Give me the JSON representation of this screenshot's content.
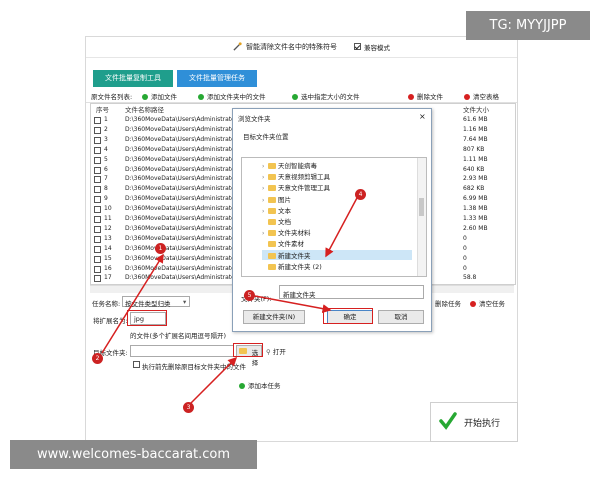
{
  "app": {
    "title": "智能清除文件名中的特殊符号",
    "compat_label": "兼容模式",
    "compat_checked": true,
    "tabs": [
      "文件批量复制工具",
      "文件批量管理任务"
    ],
    "colors": {
      "tab_active": "#1f9e8c",
      "tab_inactive": "#2f8fd8",
      "red": "#d62020",
      "green": "#27a833"
    }
  },
  "toolbar": {
    "list_label": "原文件名列表:",
    "add_files": "添加文件",
    "add_folder_files": "添加文件夹中的文件",
    "select_by_size": "选中指定大小的文件",
    "delete_files": "删除文件",
    "clear_table": "清空表格"
  },
  "table": {
    "headers": [
      "序号",
      "文件名称路径",
      "文件大小"
    ],
    "rows": [
      {
        "no": "1",
        "path": "D:\\360MoveData\\Users\\Administrator\\",
        "size": "61.6 MB"
      },
      {
        "no": "2",
        "path": "D:\\360MoveData\\Users\\Administrator\\",
        "size": "1.16 MB"
      },
      {
        "no": "3",
        "path": "D:\\360MoveData\\Users\\Administrator\\",
        "size": "7.64 MB"
      },
      {
        "no": "4",
        "path": "D:\\360MoveData\\Users\\Administrator\\",
        "size": "807 KB"
      },
      {
        "no": "5",
        "path": "D:\\360MoveData\\Users\\Administrator\\",
        "size": "1.11 MB"
      },
      {
        "no": "6",
        "path": "D:\\360MoveData\\Users\\Administrator\\",
        "size": "640 KB"
      },
      {
        "no": "7",
        "path": "D:\\360MoveData\\Users\\Administrator\\",
        "size": "2.93 MB"
      },
      {
        "no": "8",
        "path": "D:\\360MoveData\\Users\\Administrator\\",
        "size": "682 KB"
      },
      {
        "no": "9",
        "path": "D:\\360MoveData\\Users\\Administrator\\",
        "size": "6.99 MB"
      },
      {
        "no": "10",
        "path": "D:\\360MoveData\\Users\\Administrator\\",
        "size": "1.38 MB"
      },
      {
        "no": "11",
        "path": "D:\\360MoveData\\Users\\Administrator\\",
        "size": "1.33 MB"
      },
      {
        "no": "12",
        "path": "D:\\360MoveData\\Users\\Administrator\\",
        "size": "2.60 MB"
      },
      {
        "no": "13",
        "path": "D:\\360MoveData\\Users\\Administrator\\",
        "size": "0"
      },
      {
        "no": "14",
        "path": "D:\\360MoveData\\Users\\Administrator\\",
        "size": "0"
      },
      {
        "no": "15",
        "path": "D:\\360MoveData\\Users\\Administrator\\",
        "size": "0"
      },
      {
        "no": "16",
        "path": "D:\\360MoveData\\Users\\Administrator\\",
        "size": "0"
      },
      {
        "no": "17",
        "path": "D:\\360MoveData\\Users\\Administrator\\",
        "size": "58.8"
      }
    ]
  },
  "task": {
    "name_label": "任务名称:",
    "name_value": "按文件类型归类",
    "ext_label": "将扩展名为:",
    "ext_value": "jpg",
    "ext_hint": "的文件(多个扩展名间用逗号隔开)",
    "target_label": "目标文件夹:",
    "select_btn": "选择",
    "open_btn": "打开",
    "delete_before": "执行前先删除原目标文件夹中的文件",
    "add_task": "添加本任务",
    "delete_task": "删除任务",
    "clear_task": "清空任务",
    "start": "开始执行"
  },
  "dialog": {
    "title": "浏览文件夹",
    "subtitle": "目标文件夹位置",
    "tree": [
      {
        "label": "天创智能病毒",
        "arrow": true
      },
      {
        "label": "天意视频剪辑工具",
        "arrow": true
      },
      {
        "label": "天意文件管理工具",
        "arrow": true
      },
      {
        "label": "图片",
        "arrow": true
      },
      {
        "label": "文本",
        "arrow": true
      },
      {
        "label": "文档",
        "arrow": false
      },
      {
        "label": "文件夹材料",
        "arrow": true
      },
      {
        "label": "文件素材",
        "arrow": false
      },
      {
        "label": "新建文件夹",
        "arrow": false,
        "selected": true
      },
      {
        "label": "新建文件夹 (2)",
        "arrow": false
      }
    ],
    "folder_label": "文件夹(F):",
    "folder_value": "新建文件夹",
    "new_folder": "新建文件夹(N)",
    "ok": "确定",
    "cancel": "取消"
  },
  "markers": [
    "1",
    "2",
    "3",
    "4",
    "5"
  ],
  "watermarks": {
    "top_right": "TG: MYYJJPP",
    "bottom_left": "www.welcomes-baccarat.com"
  }
}
